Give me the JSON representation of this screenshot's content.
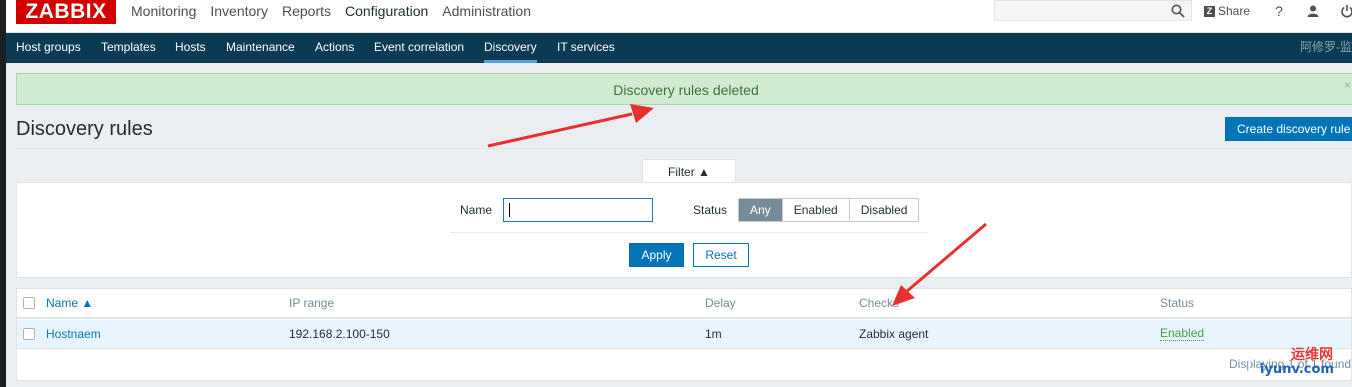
{
  "app": {
    "logo": "ZABBIX"
  },
  "main_menu": [
    {
      "label": "Monitoring",
      "active": false
    },
    {
      "label": "Inventory",
      "active": false
    },
    {
      "label": "Reports",
      "active": false
    },
    {
      "label": "Configuration",
      "active": true
    },
    {
      "label": "Administration",
      "active": false
    }
  ],
  "search": {
    "placeholder": "",
    "icon": "search-icon"
  },
  "top_right": {
    "share_label": "Share",
    "help_icon": "question-icon",
    "user_icon": "user-icon",
    "signout_icon": "power-icon"
  },
  "sub_menu": [
    {
      "label": "Host groups",
      "active": false
    },
    {
      "label": "Templates",
      "active": false
    },
    {
      "label": "Hosts",
      "active": false
    },
    {
      "label": "Maintenance",
      "active": false
    },
    {
      "label": "Actions",
      "active": false
    },
    {
      "label": "Event correlation",
      "active": false
    },
    {
      "label": "Discovery",
      "active": true
    },
    {
      "label": "IT services",
      "active": false
    }
  ],
  "sub_menu_user": "阿修罗-监",
  "alert": {
    "message": "Discovery rules deleted",
    "close": "×"
  },
  "page": {
    "title": "Discovery rules",
    "create_button": "Create discovery rule"
  },
  "filter": {
    "tab_label": "Filter ▲",
    "name_label": "Name",
    "name_value": "",
    "status_label": "Status",
    "status_options": [
      "Any",
      "Enabled",
      "Disabled"
    ],
    "status_selected": "Any",
    "apply_label": "Apply",
    "reset_label": "Reset"
  },
  "table": {
    "columns": [
      "Name ▲",
      "IP range",
      "Delay",
      "Checks",
      "Status"
    ],
    "rows": [
      {
        "name": "Hostnaem",
        "ip_range": "192.168.2.100-150",
        "delay": "1m",
        "checks": "Zabbix agent",
        "status": "Enabled"
      }
    ],
    "footer": "Displaying 1 of 1 found"
  },
  "watermark": {
    "text_cn": "运维网",
    "text_url": "iyunv.com"
  },
  "colors": {
    "brand": "#d40000",
    "nav": "#0b3a53",
    "accent": "#0275b8",
    "success_bg": "#d1ebd1",
    "arrow": "#e8302f"
  }
}
